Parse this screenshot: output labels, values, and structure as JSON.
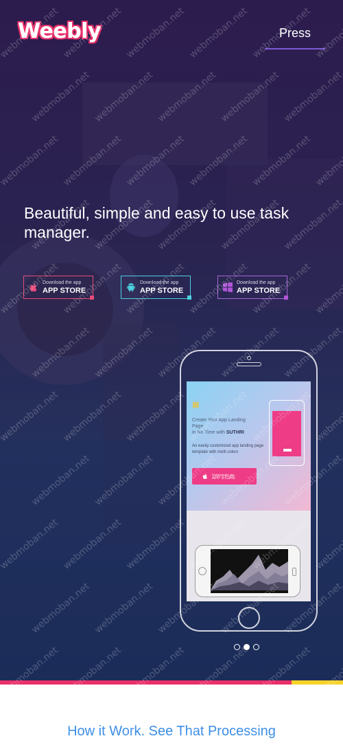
{
  "header": {
    "logo": "Weebly",
    "nav": {
      "press": "Press"
    }
  },
  "hero": {
    "headline": "Beautiful, simple and easy to use task manager.",
    "store_buttons": [
      {
        "small": "Download the app",
        "label": "APP STORE",
        "icon": "apple-icon",
        "accent": "#e84b7a"
      },
      {
        "small": "Download the app",
        "label": "APP STORE",
        "icon": "android-icon",
        "accent": "#4dd0e0"
      },
      {
        "small": "Download the app",
        "label": "APP STORE",
        "icon": "windows-icon",
        "accent": "#b155d8"
      }
    ],
    "carousel": {
      "slides": 3,
      "active": 2
    }
  },
  "mockup": {
    "title_line1": "Create Your App Landing Page",
    "title_line2": "in No Time with",
    "brand": "SUTHRI",
    "description": "An easily customized app landing page template with multi colors",
    "button_small": "Download the app",
    "button_label": "APP STORE"
  },
  "section": {
    "title": "How it Work. See That Processing"
  },
  "watermark": "webmoban.net",
  "colors": {
    "accent_pink": "#e8306a",
    "accent_yellow": "#f6d32a",
    "heading_blue": "#3c8ee6",
    "nav_underline": "#7d5bd6"
  }
}
